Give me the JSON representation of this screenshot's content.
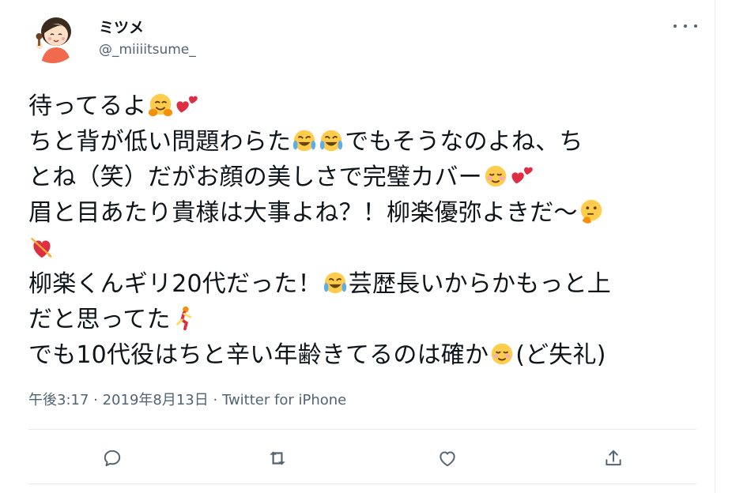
{
  "user": {
    "display_name": "ミツメ",
    "handle": "@_miiiitsume_"
  },
  "tweet": {
    "lines": [
      "待ってるよ",
      "ちと背が低い問題わらた",
      "でもそうなのよね、ち",
      "とね（笑）だがお顔の美しさで完璧カバー",
      "眉と目あたり貴様は大事よね？！柳楽優弥よきだ〜",
      "柳楽くんギリ20代だった！",
      "芸歴長いからかもっと上",
      "だと思ってた",
      "でも10代役はちと辛い年齢きてるのは確か",
      "(ど失礼)"
    ]
  },
  "meta": {
    "time": "午後3:17",
    "sep1": " · ",
    "date": "2019年8月13日",
    "sep2": " · ",
    "source": "Twitter for iPhone"
  },
  "icons": {
    "more": "more-dots-icon",
    "reply": "reply-icon",
    "retweet": "retweet-icon",
    "like": "heart-icon",
    "share": "share-icon"
  },
  "colors": {
    "text": "#0f1419",
    "muted": "#536471",
    "border": "#e6ecf0"
  }
}
